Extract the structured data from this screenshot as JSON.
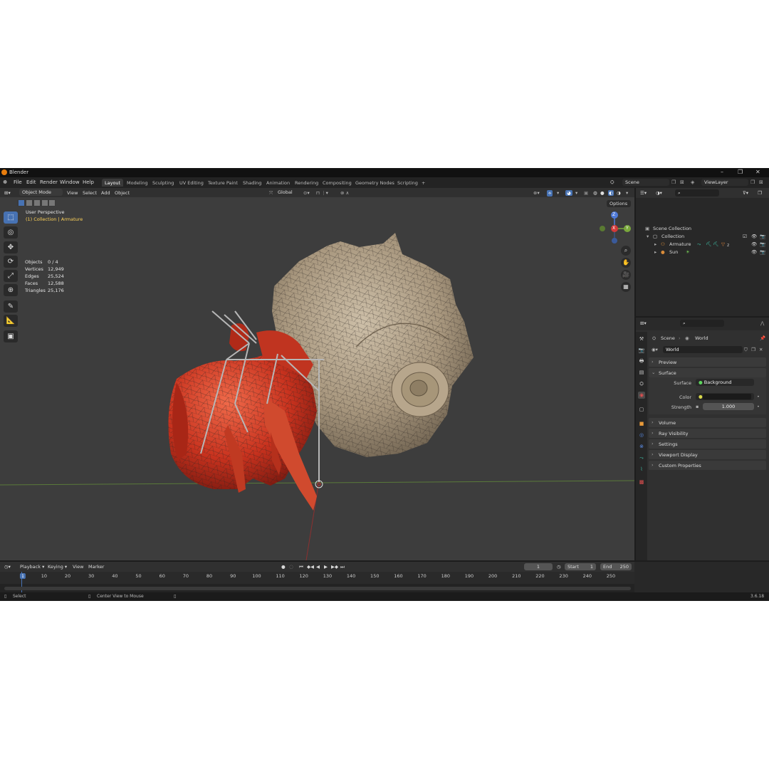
{
  "window": {
    "title": "Blender"
  },
  "menus": [
    "File",
    "Edit",
    "Render",
    "Window",
    "Help"
  ],
  "workspaces": [
    "Layout",
    "Modeling",
    "Sculpting",
    "UV Editing",
    "Texture Paint",
    "Shading",
    "Animation",
    "Rendering",
    "Compositing",
    "Geometry Nodes",
    "Scripting",
    "+"
  ],
  "scene_selector": {
    "value": "Scene"
  },
  "view_layer_selector": {
    "value": "ViewLayer"
  },
  "viewport_header": {
    "mode": "Object Mode",
    "menus": [
      "View",
      "Select",
      "Add",
      "Object"
    ],
    "orientation": "Global",
    "options": "Options"
  },
  "viewport_overlay": {
    "view_name": "User Perspective",
    "context": "(1) Collection | Armature"
  },
  "stats": [
    {
      "label": "Objects",
      "value": "0 / 4"
    },
    {
      "label": "Vertices",
      "value": "12,949"
    },
    {
      "label": "Edges",
      "value": "25,524"
    },
    {
      "label": "Faces",
      "value": "12,588"
    },
    {
      "label": "Triangles",
      "value": "25,176"
    }
  ],
  "gizmo": {
    "z": "Z",
    "x": "X",
    "y": "Y"
  },
  "outliner": {
    "root": "Scene Collection",
    "collection": "Collection",
    "items": [
      {
        "name": "Armature"
      },
      {
        "name": "Sun"
      }
    ],
    "armature_modifier_count": "2"
  },
  "properties": {
    "breadcrumb": {
      "scene": "Scene",
      "world": "World"
    },
    "world_name": "World",
    "panels": {
      "preview": "Preview",
      "surface": "Surface",
      "volume": "Volume",
      "ray_visibility": "Ray Visibility",
      "settings": "Settings",
      "viewport_display": "Viewport Display",
      "custom_properties": "Custom Properties"
    },
    "surface_label": "Surface",
    "surface_value": "Background",
    "color_label": "Color",
    "color_value": "#1a1a1a",
    "strength_label": "Strength",
    "strength_value": "1.000"
  },
  "timeline": {
    "menus": [
      "Playback",
      "Keying",
      "View",
      "Marker"
    ],
    "current_frame": "1",
    "start_label": "Start",
    "start_value": "1",
    "end_label": "End",
    "end_value": "250",
    "ticks": [
      "1",
      "10",
      "20",
      "30",
      "40",
      "50",
      "60",
      "70",
      "80",
      "90",
      "100",
      "110",
      "120",
      "130",
      "140",
      "150",
      "160",
      "170",
      "180",
      "190",
      "200",
      "210",
      "220",
      "230",
      "240",
      "250"
    ]
  },
  "statusbar": {
    "left": "Select",
    "middle": "Center View to Mouse",
    "version": "3.6.18"
  },
  "colors": {
    "accent": "#4772b3",
    "active_text": "#ffd35a",
    "crab": "#c8321e",
    "shell": "#b4a58e"
  }
}
